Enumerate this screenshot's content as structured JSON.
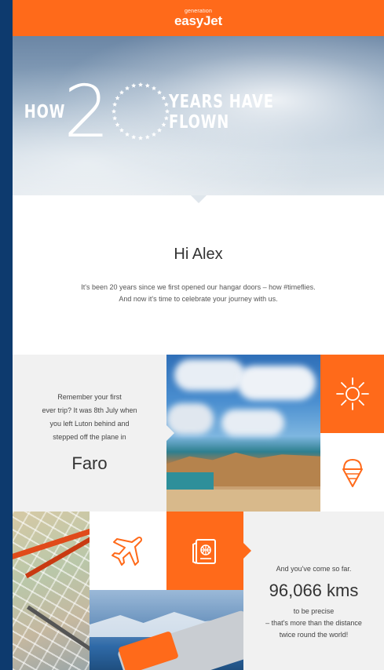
{
  "header": {
    "brand_small": "generation",
    "brand_main": "easyJet"
  },
  "hero": {
    "word_left": "HOW",
    "number": "2",
    "word_right": "YEARS HAVE FLOWN"
  },
  "greeting": {
    "title": "Hi Alex",
    "line1": "It's been 20 years since we first opened our hangar doors – how #timeflies.",
    "line2": "And now it's time to celebrate your journey with us."
  },
  "first_trip": {
    "line1": "Remember your first",
    "line2": "ever trip? It was 8th July when",
    "line3": "you left Luton behind and",
    "line4": "stepped off the plane in",
    "city": "Faro"
  },
  "distance": {
    "intro": "And you've come so far.",
    "value": "96,066 kms",
    "line1": "to be precise",
    "line2": "– that's more than the distance",
    "line3": "twice round the world!"
  },
  "icons": {
    "sun": "sun-icon",
    "ice_cream": "ice-cream-icon",
    "plane": "plane-icon",
    "passport": "passport-icon",
    "stars": "star-ring-icon"
  },
  "colors": {
    "brand_orange": "#ff6a1a",
    "page_background": "#0d3a6e",
    "panel_grey": "#f1f1f1"
  }
}
